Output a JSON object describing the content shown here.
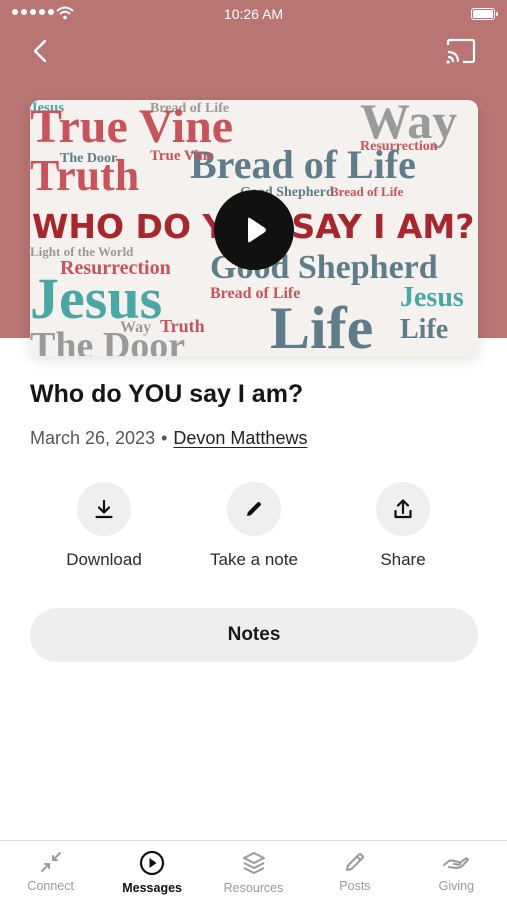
{
  "status_bar": {
    "time": "10:26 AM"
  },
  "artwork": {
    "words": {
      "true_vine": "True Vine",
      "way": "Way",
      "truth": "Truth",
      "bread_of_life": "Bread of Life",
      "headline": "WHO DO YOU SAY I AM?",
      "resurrection": "Resurrection",
      "good_shepherd": "Good Shepherd",
      "jesus": "Jesus",
      "life": "Life",
      "the_door": "The Door",
      "light_of_the_world": "Light of the World"
    }
  },
  "message": {
    "title": "Who do YOU say I am?",
    "date": "March 26, 2023",
    "separator": "•",
    "author": "Devon Matthews"
  },
  "actions": {
    "download": {
      "label": "Download",
      "icon": "download-icon"
    },
    "note": {
      "label": "Take a note",
      "icon": "pencil-icon"
    },
    "share": {
      "label": "Share",
      "icon": "share-icon"
    }
  },
  "notes_button": {
    "label": "Notes"
  },
  "tab_bar": {
    "connect": "Connect",
    "messages": "Messages",
    "resources": "Resources",
    "posts": "Posts",
    "giving": "Giving"
  },
  "colors": {
    "header_bg": "#b87574",
    "word_red": "#c9535a",
    "word_teal": "#4aa7a6",
    "word_slate": "#5f7c8a",
    "word_gray": "#9a9a9a",
    "headline": "#a8272c"
  }
}
